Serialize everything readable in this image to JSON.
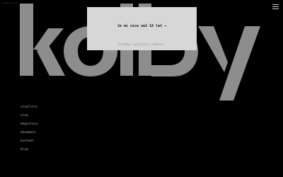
{
  "topbar": {
    "text": "kolby kolby"
  },
  "logo": {
    "text": "kolby",
    "color": "#8d8d8d"
  },
  "menu_icon": {
    "name": "hamburger-menu-icon"
  },
  "nav": {
    "items": [
      "vinařství",
      "vína",
      "degustace",
      "akademie",
      "kontakt",
      "blog"
    ]
  },
  "age_gate": {
    "question": "Je mi více než 18 let →",
    "note": "Stránky využívají cookies.",
    "background": "#d7d7d7"
  }
}
